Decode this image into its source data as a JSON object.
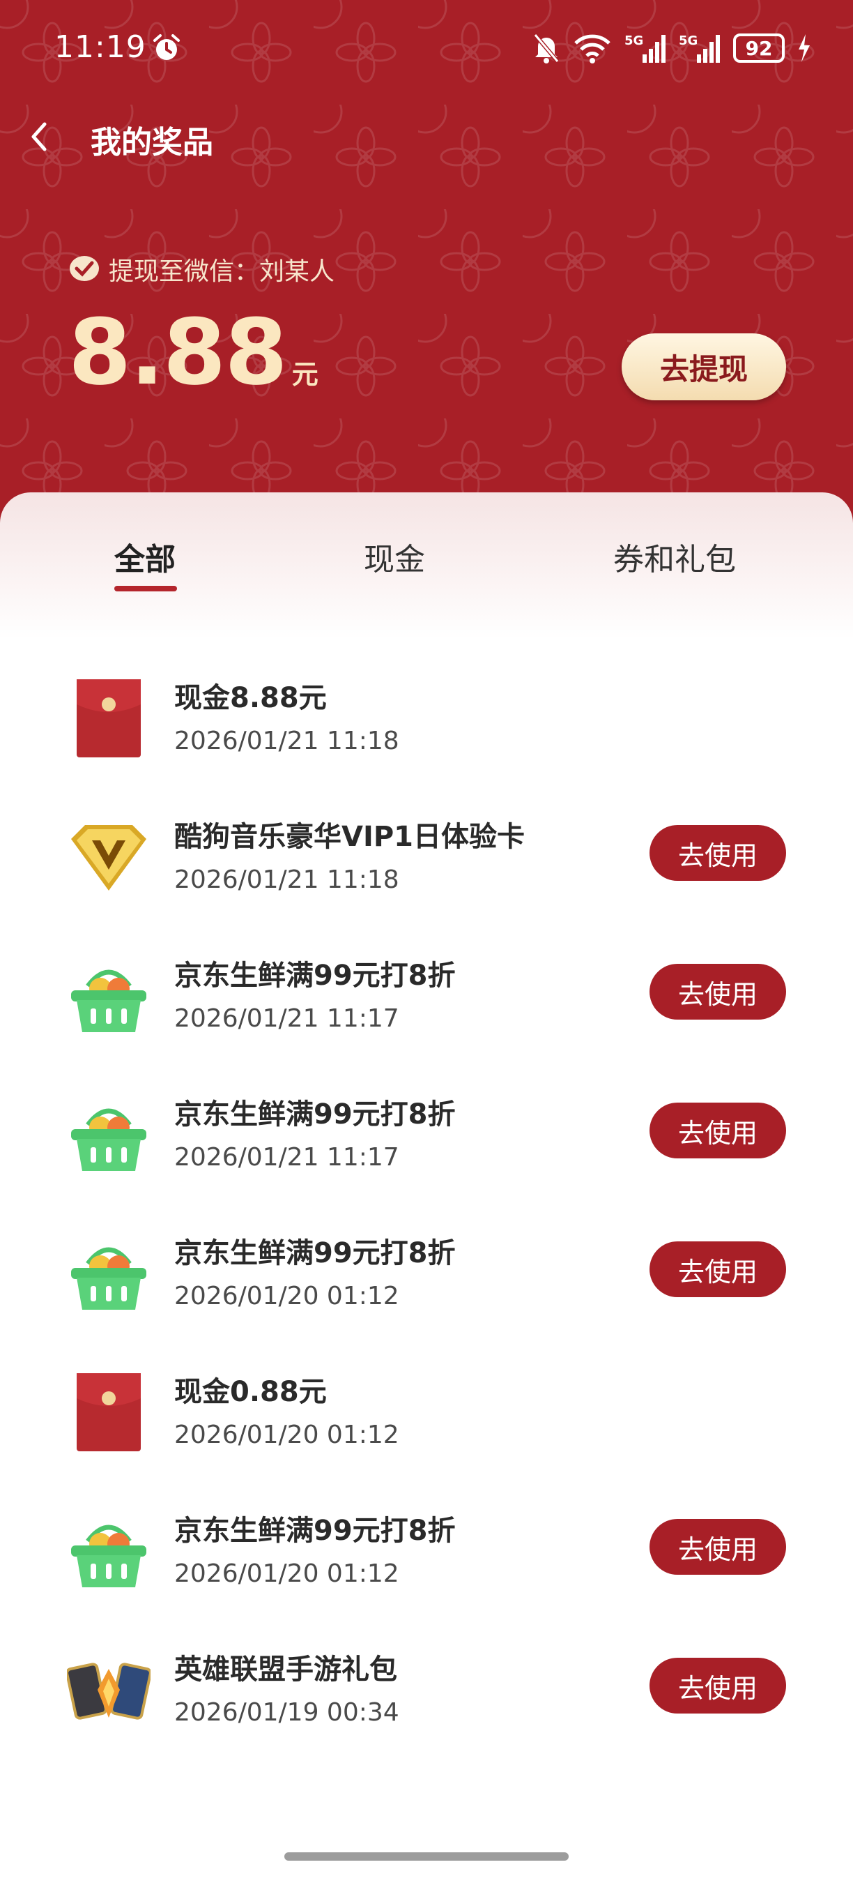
{
  "status_bar": {
    "time": "11:19",
    "battery": "92",
    "network_1": "5G",
    "network_2": "5G"
  },
  "nav": {
    "title": "我的奖品"
  },
  "withdraw": {
    "wechat_text": "提现至微信：刘某人",
    "amount": "8.88",
    "unit": "元",
    "button_label": "去提现"
  },
  "tabs": [
    {
      "label": "全部"
    },
    {
      "label": "现金"
    },
    {
      "label": "券和礼包"
    }
  ],
  "prizes": [
    {
      "title": "现金8.88元",
      "date": "2026/01/21 11:18",
      "icon": "red-envelope-icon",
      "button": ""
    },
    {
      "title": "酷狗音乐豪华VIP1日体验卡",
      "date": "2026/01/21 11:18",
      "icon": "vip-diamond-icon",
      "button": "去使用"
    },
    {
      "title": "京东生鲜满99元打8折",
      "date": "2026/01/21 11:17",
      "icon": "fresh-basket-icon",
      "button": "去使用"
    },
    {
      "title": "京东生鲜满99元打8折",
      "date": "2026/01/21 11:17",
      "icon": "fresh-basket-icon",
      "button": "去使用"
    },
    {
      "title": "京东生鲜满99元打8折",
      "date": "2026/01/20 01:12",
      "icon": "fresh-basket-icon",
      "button": "去使用"
    },
    {
      "title": "现金0.88元",
      "date": "2026/01/20 01:12",
      "icon": "red-envelope-icon",
      "button": ""
    },
    {
      "title": "京东生鲜满99元打8折",
      "date": "2026/01/20 01:12",
      "icon": "fresh-basket-icon",
      "button": "去使用"
    },
    {
      "title": "英雄联盟手游礼包",
      "date": "2026/01/19 00:34",
      "icon": "game-giftpack-icon",
      "button": "去使用"
    }
  ],
  "colors": {
    "brand_red": "#a81f27",
    "gold": "#fbe7c0"
  }
}
